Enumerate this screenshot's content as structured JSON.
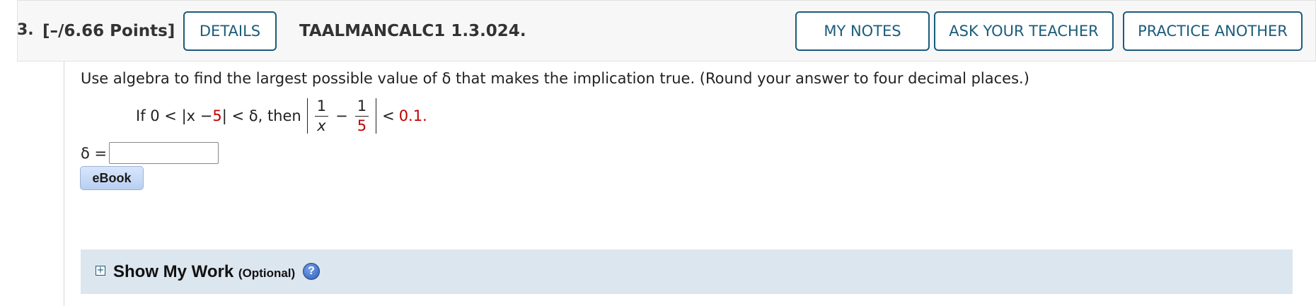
{
  "header": {
    "question_number": "3.",
    "points": "[–/6.66 Points]",
    "details_label": "DETAILS",
    "problem_code": "TAALMANCALC1 1.3.024.",
    "my_notes_label": "MY NOTES",
    "ask_teacher_label": "ASK YOUR TEACHER",
    "practice_label": "PRACTICE ANOTHER"
  },
  "problem": {
    "prompt": "Use algebra to find the largest possible value of δ that makes the implication true. (Round your answer to four decimal places.)",
    "eq_if": "If 0 < |x − ",
    "eq_a": "5",
    "eq_mid": "| < δ, then",
    "frac1_num": "1",
    "frac1_den": "x",
    "minus": "−",
    "frac2_num": "1",
    "frac2_den": "5",
    "eq_lt": "<",
    "eq_eps": "0.1.",
    "answer_label": "δ =",
    "answer_value": "",
    "ebook_label": "eBook"
  },
  "show_work": {
    "expand_icon": "plus-box-icon",
    "title": "Show My Work",
    "optional": "(Optional)",
    "help_icon": "question-icon",
    "help_glyph": "?"
  },
  "colors": {
    "accent": "#1b5c7a",
    "highlight_red": "#c00000",
    "panel_bg": "#dce6ef"
  }
}
